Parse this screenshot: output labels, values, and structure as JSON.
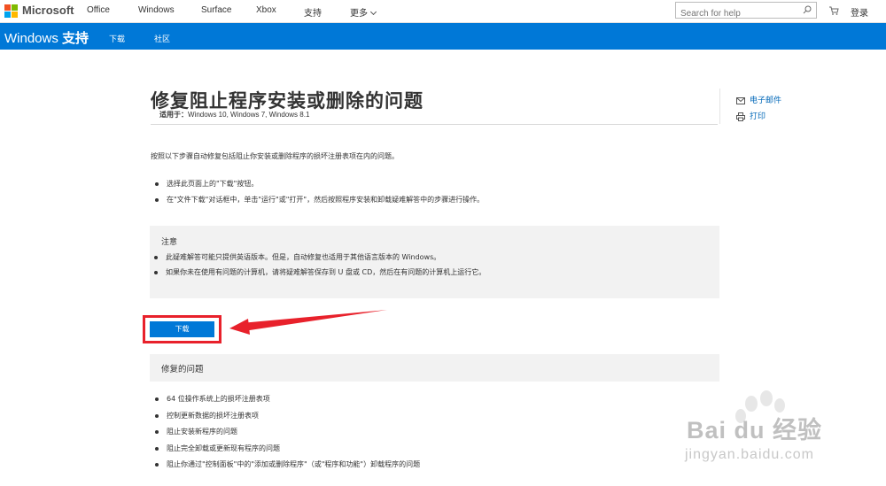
{
  "topbar": {
    "brand": "Microsoft",
    "nav": [
      "Office",
      "Windows",
      "Surface",
      "Xbox",
      "支持",
      "更多"
    ],
    "search_placeholder": "Search for help",
    "signin": "登录"
  },
  "bluebar": {
    "title_prefix": "Windows",
    "title_suffix": "支持",
    "nav": [
      "下载",
      "社区"
    ]
  },
  "article": {
    "title": "修复阻止程序安装或删除的问题",
    "applies_label": "适用于：",
    "applies_value": "Windows 10, Windows 7, Windows 8.1",
    "intro": "按照以下步骤自动修复包括阻止你安装或删除程序的损坏注册表项在内的问题。",
    "steps": [
      "选择此页面上的\"下载\"按钮。",
      "在\"文件下载\"对话框中，单击\"运行\"或\"打开\"，然后按照程序安装和卸载疑难解答中的步骤进行操作。"
    ],
    "note_title": "注意",
    "notes": [
      "此疑难解答可能只提供英语版本。但是，自动修复也适用于其他语言版本的 Windows。",
      "如果你未在使用有问题的计算机，请将疑难解答保存到 U 盘或 CD，然后在有问题的计算机上运行它。"
    ],
    "download_label": "下载",
    "fixed_title": "修复的问题",
    "fixed": [
      "64 位操作系统上的损坏注册表项",
      "控制更新数据的损坏注册表项",
      "阻止安装新程序的问题",
      "阻止完全卸载或更新现有程序的问题",
      "阻止你通过\"控制面板\"中的\"添加或删除程序\"（或\"程序和功能\"）卸载程序的问题"
    ]
  },
  "share": {
    "email": "电子邮件",
    "print": "打印"
  },
  "watermark": {
    "text": "Bai du 经验",
    "url": "jingyan.baidu.com"
  },
  "colors": {
    "accent": "#0078d7",
    "highlight": "#e8212b",
    "panel": "#f2f2f2"
  }
}
